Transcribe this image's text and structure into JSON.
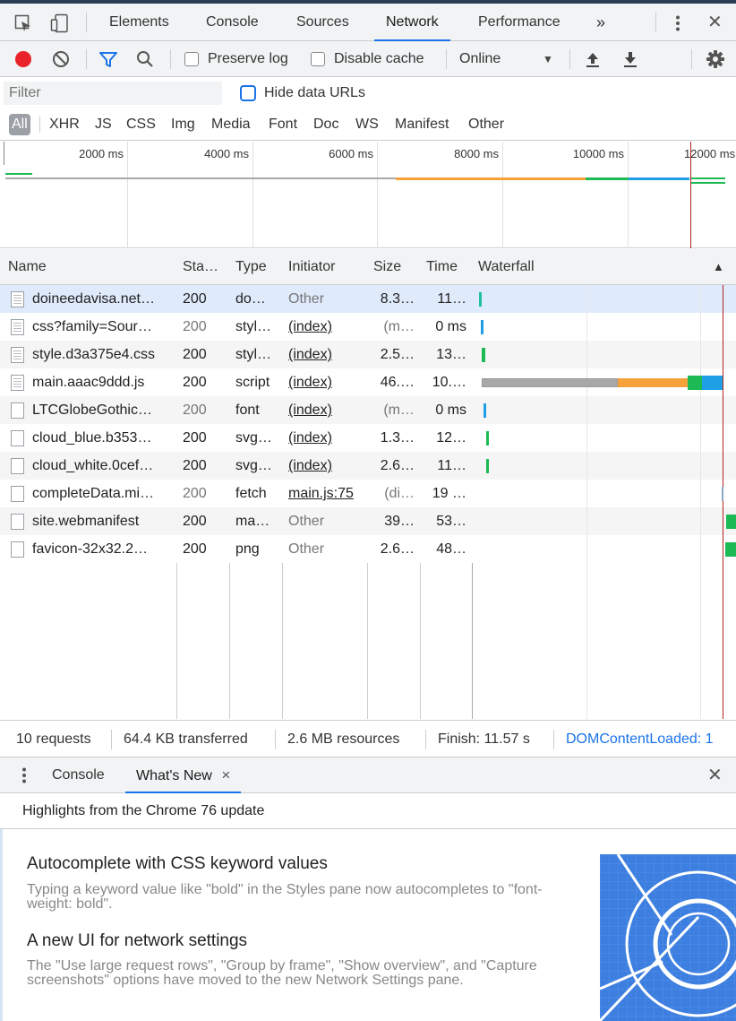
{
  "tabbar": {
    "tabs": [
      "Elements",
      "Console",
      "Sources",
      "Network",
      "Performance"
    ],
    "active": "Network",
    "overflow": "»",
    "close": "✕"
  },
  "toolbar": {
    "preserve_log": "Preserve log",
    "disable_cache": "Disable cache",
    "throttling": "Online"
  },
  "filter": {
    "placeholder": "Filter",
    "hide_data_urls": "Hide data URLs",
    "types": [
      "All",
      "XHR",
      "JS",
      "CSS",
      "Img",
      "Media",
      "Font",
      "Doc",
      "WS",
      "Manifest",
      "Other"
    ]
  },
  "overview": {
    "ticks": [
      "2000 ms",
      "4000 ms",
      "6000 ms",
      "8000 ms",
      "10000 ms",
      "12000 ms"
    ]
  },
  "table": {
    "headers": [
      "Name",
      "Sta…",
      "Type",
      "Initiator",
      "Size",
      "Time",
      "Waterfall"
    ],
    "sort_indicator": "▲",
    "rows": [
      {
        "name": "doineedavisa.net…",
        "status": "200",
        "type": "do…",
        "initiator": "Other",
        "size": "8.3…",
        "time": "11…"
      },
      {
        "name": "css?family=Sour…",
        "status": "200",
        "type": "styl…",
        "initiator": "(index)",
        "size": "(m…",
        "time": "0 ms"
      },
      {
        "name": "style.d3a375e4.css",
        "status": "200",
        "type": "styl…",
        "initiator": "(index)",
        "size": "2.5…",
        "time": "13…"
      },
      {
        "name": "main.aaac9ddd.js",
        "status": "200",
        "type": "script",
        "initiator": "(index)",
        "size": "46.…",
        "time": "10.…"
      },
      {
        "name": "LTCGlobeGothic…",
        "status": "200",
        "type": "font",
        "initiator": "(index)",
        "size": "(m…",
        "time": "0 ms"
      },
      {
        "name": "cloud_blue.b353…",
        "status": "200",
        "type": "svg…",
        "initiator": "(index)",
        "size": "1.3…",
        "time": "12…"
      },
      {
        "name": "cloud_white.0cef…",
        "status": "200",
        "type": "svg…",
        "initiator": "(index)",
        "size": "2.6…",
        "time": "11…"
      },
      {
        "name": "completeData.mi…",
        "status": "200",
        "type": "fetch",
        "initiator": "main.js:75",
        "size": "(di…",
        "time": "19 …"
      },
      {
        "name": "site.webmanifest",
        "status": "200",
        "type": "ma…",
        "initiator": "Other",
        "size": "39…",
        "time": "53…"
      },
      {
        "name": "favicon-32x32.2…",
        "status": "200",
        "type": "png",
        "initiator": "Other",
        "size": "2.6…",
        "time": "48…"
      }
    ]
  },
  "summary": {
    "requests": "10 requests",
    "transferred": "64.4 KB transferred",
    "resources": "2.6 MB resources",
    "finish": "Finish: 11.57 s",
    "dcl": "DOMContentLoaded: 1"
  },
  "drawer": {
    "tabs": [
      "Console",
      "What's New"
    ],
    "tab_close": "×",
    "close": "✕",
    "highlights": "Highlights from the Chrome 76 update",
    "articles": [
      {
        "title": "Autocomplete with CSS keyword values",
        "desc": "Typing a keyword value like \"bold\" in the Styles pane now autocompletes to \"font-weight: bold\"."
      },
      {
        "title": "A new UI for network settings",
        "desc": "The \"Use large request rows\", \"Group by frame\", \"Show overview\", and \"Capture screenshots\" options have moved to the new Network Settings pane."
      }
    ]
  },
  "colors": {
    "accent": "#1a73e8",
    "record": "#e8232a",
    "waterfall_queue": "#a8a8a8",
    "waterfall_wait": "#f7a13b",
    "waterfall_green": "#1db954",
    "waterfall_blue": "#1fa0e6",
    "load_line": "#b22222"
  }
}
